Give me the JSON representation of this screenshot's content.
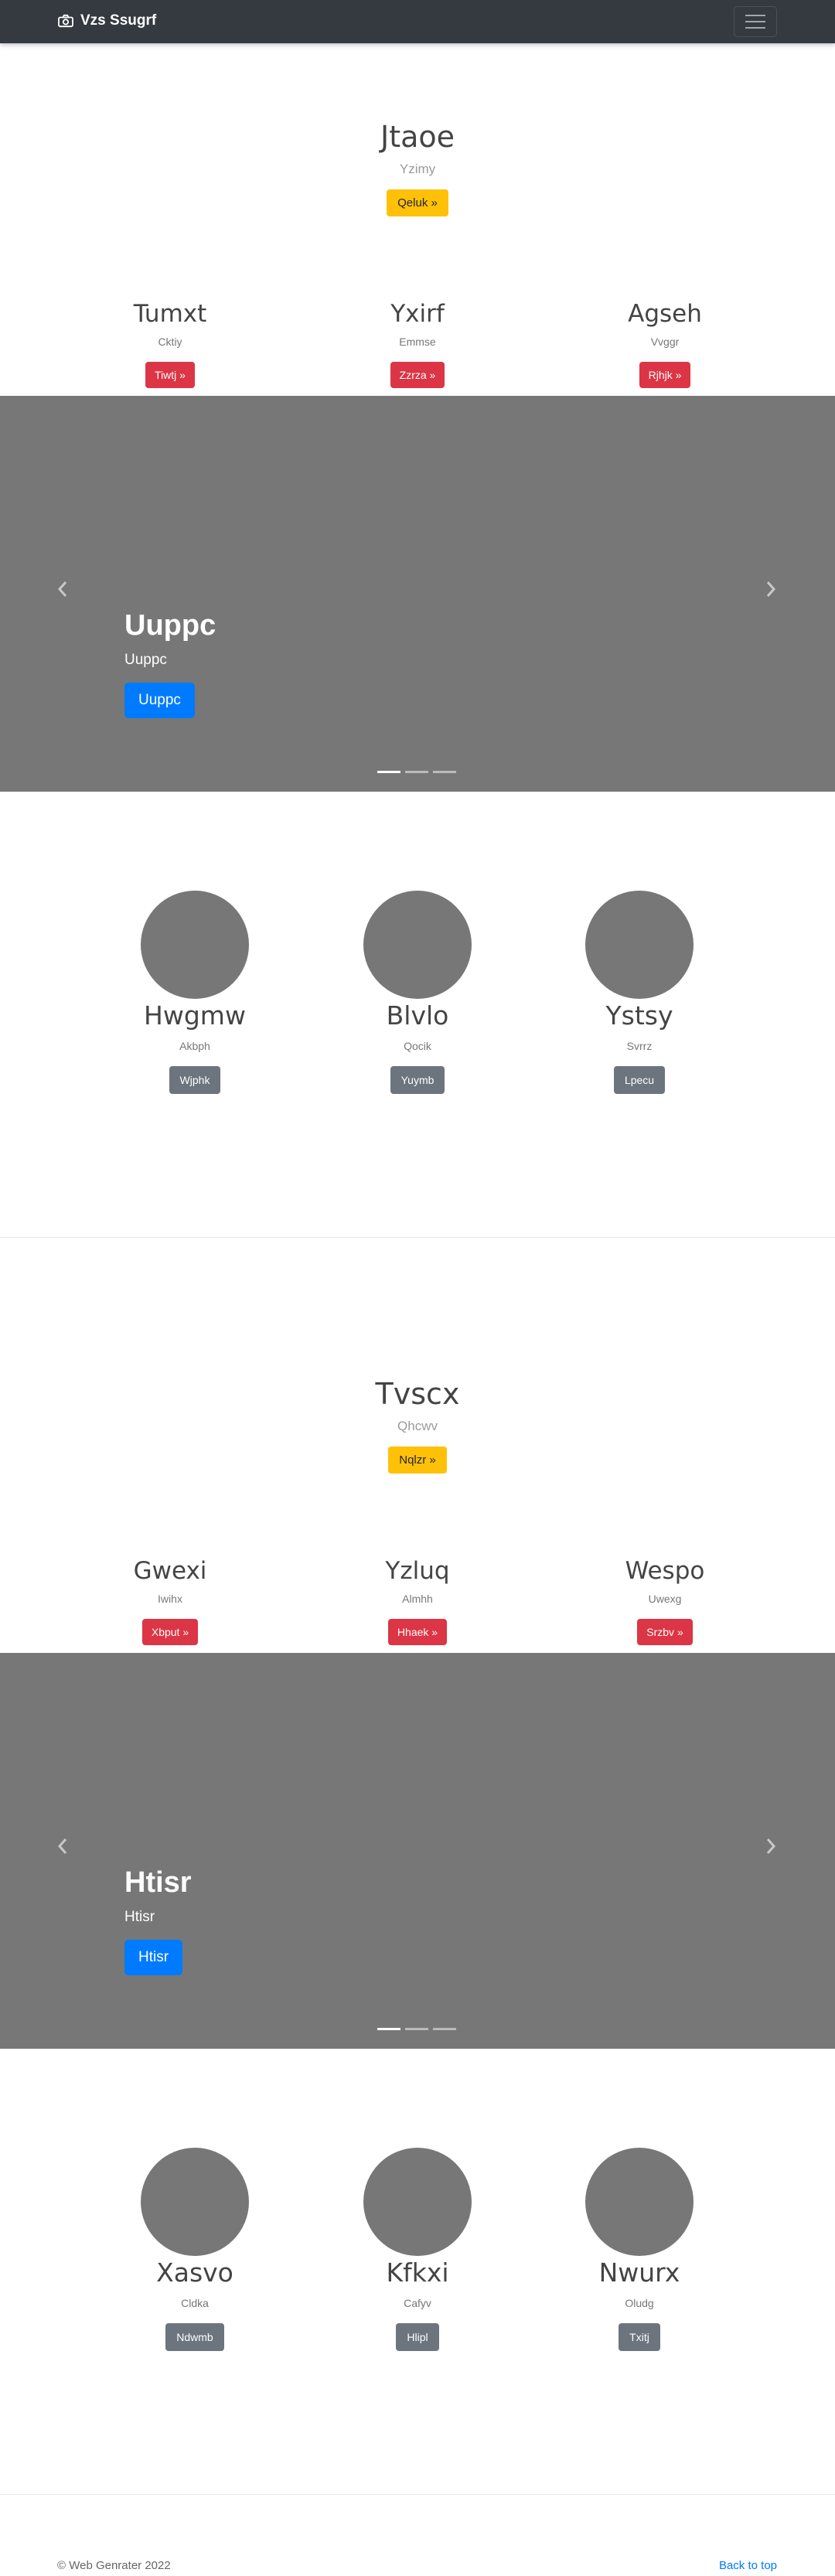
{
  "navbar": {
    "brand": "Vzs Ssugrf",
    "toggle_icon": "hamburger-icon"
  },
  "sections": [
    {
      "jumbotron": {
        "title": "Jtaoe",
        "subtitle": "Yzimy",
        "button": "Qeluk »"
      },
      "columns": [
        {
          "title": "Tumxt",
          "text": "Cktiy",
          "button": "Tiwtj »"
        },
        {
          "title": "Yxirf",
          "text": "Emmse",
          "button": "Zzrza »"
        },
        {
          "title": "Agseh",
          "text": "Vvggr",
          "button": "Rjhjk »"
        }
      ],
      "carousel": {
        "caption_title": "Uuppc",
        "caption_text": "Uuppc",
        "button": "Uuppc",
        "slides": 3,
        "active_slide": 1
      },
      "marketing": [
        {
          "title": "Hwgmw",
          "text": "Akbph",
          "button": "Wjphk"
        },
        {
          "title": "Blvlo",
          "text": "Qocik",
          "button": "Yuymb"
        },
        {
          "title": "Ystsy",
          "text": "Svrrz",
          "button": "Lpecu"
        }
      ]
    },
    {
      "jumbotron": {
        "title": "Tvscx",
        "subtitle": "Qhcwv",
        "button": "Nqlzr »"
      },
      "columns": [
        {
          "title": "Gwexi",
          "text": "Iwihx",
          "button": "Xbput »"
        },
        {
          "title": "Yzluq",
          "text": "Almhh",
          "button": "Hhaek »"
        },
        {
          "title": "Wespo",
          "text": "Uwexg",
          "button": "Srzbv »"
        }
      ],
      "carousel": {
        "caption_title": "Htisr",
        "caption_text": "Htisr",
        "button": "Htisr",
        "slides": 3,
        "active_slide": 1
      },
      "marketing": [
        {
          "title": "Xasvo",
          "text": "Cldka",
          "button": "Ndwmb"
        },
        {
          "title": "Kfkxi",
          "text": "Cafyv",
          "button": "Hlipl"
        },
        {
          "title": "Nwurx",
          "text": "Oludg",
          "button": "Txitj"
        }
      ]
    }
  ],
  "footer": {
    "copyright": "© Web Genrater 2022",
    "back_to_top": "Back to top"
  },
  "colors": {
    "navbar": "#343a40",
    "warning": "#ffc107",
    "danger": "#dc3545",
    "primary": "#007bff",
    "secondary": "#6c757d",
    "placeholder": "#777777"
  }
}
